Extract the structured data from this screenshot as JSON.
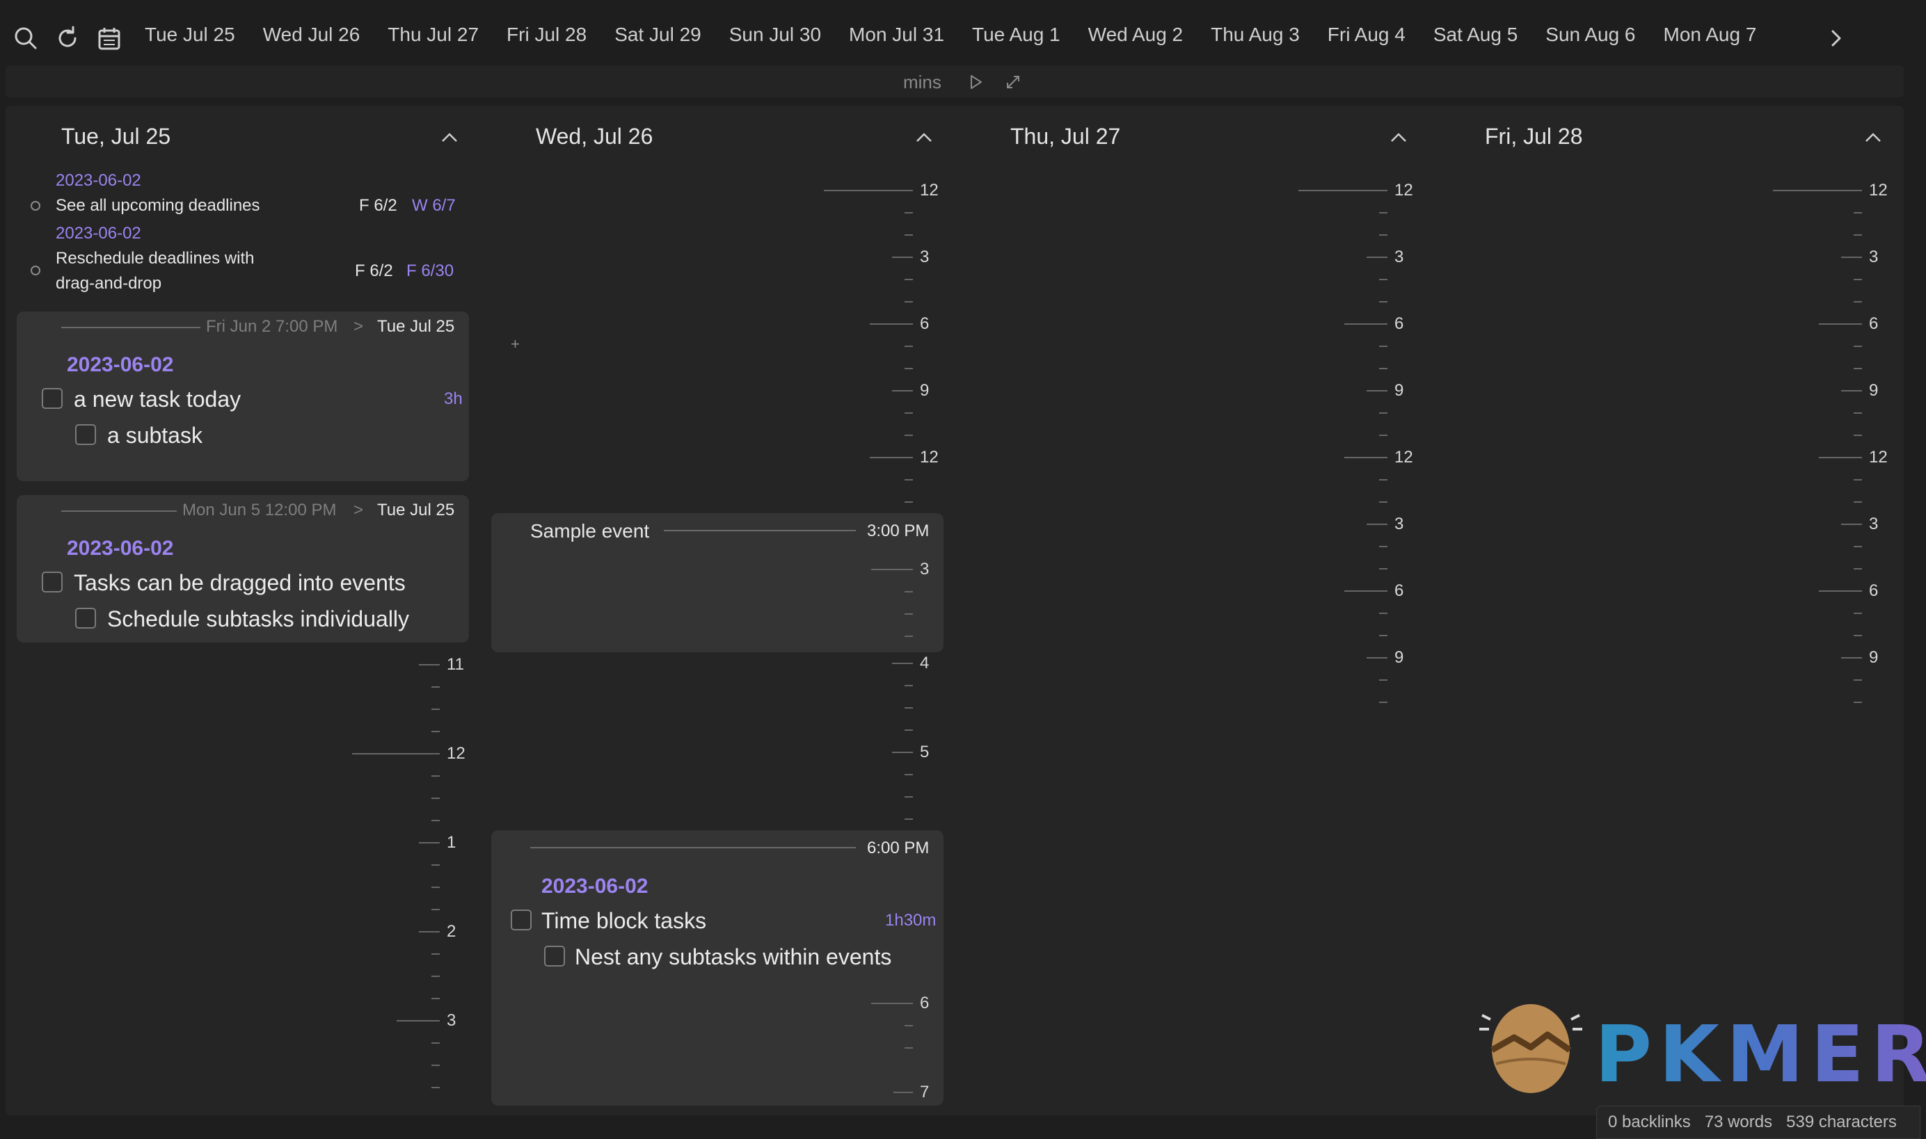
{
  "nav": {
    "dates": [
      "Tue Jul 25",
      "Wed Jul 26",
      "Thu Jul 27",
      "Fri Jul 28",
      "Sat Jul 29",
      "Sun Jul 30",
      "Mon Jul 31",
      "Tue Aug 1",
      "Wed Aug 2",
      "Thu Aug 3",
      "Fri Aug 4",
      "Sat Aug 5",
      "Sun Aug 6",
      "Mon Aug 7"
    ]
  },
  "controls": {
    "unit_label": "mins"
  },
  "columns": [
    {
      "title": "Tue, Jul 25",
      "deadlines": [
        {
          "date": "2023-06-02",
          "text": "See all upcoming deadlines",
          "from": "F 6/2",
          "to": "W 6/7"
        },
        {
          "date": "2023-06-02",
          "text_line1": "Reschedule deadlines with",
          "text_line2": "drag-and-drop",
          "from": "F 6/2",
          "to": "F 6/30"
        }
      ],
      "cards": [
        {
          "from": "Fri Jun 2 7:00 PM",
          "arrow": ">",
          "to": "Tue Jul 25",
          "heading": "2023-06-02",
          "task": "a new task today",
          "duration": "3h",
          "subtask": "a subtask"
        },
        {
          "from": "Mon Jun 5 12:00 PM",
          "arrow": ">",
          "to": "Tue Jul 25",
          "heading": "2023-06-02",
          "task": "Tasks can be dragged into events",
          "subtask": "Schedule subtasks individually"
        }
      ],
      "ticks": [
        "11",
        "12",
        "1",
        "2",
        "3"
      ]
    },
    {
      "title": "Wed, Jul 26",
      "add_symbol": "+",
      "ticks_top": [
        "12",
        "3",
        "6",
        "9",
        "12"
      ],
      "event1": {
        "title": "Sample event",
        "time": "3:00 PM",
        "tick": "3"
      },
      "ticks_mid": [
        "4",
        "5"
      ],
      "event2": {
        "time": "6:00 PM",
        "heading": "2023-06-02",
        "task": "Time block tasks",
        "duration": "1h30m",
        "subtask": "Nest any subtasks within events",
        "ticks": [
          "6",
          "7"
        ]
      }
    },
    {
      "title": "Thu, Jul 27",
      "ticks": [
        "12",
        "3",
        "6",
        "9",
        "12",
        "3",
        "6",
        "9"
      ]
    },
    {
      "title": "Fri, Jul 28",
      "ticks": [
        "12",
        "3",
        "6",
        "9",
        "12",
        "3",
        "6",
        "9"
      ]
    }
  ],
  "watermark": {
    "text": "PKMER"
  },
  "status": {
    "backlinks": "0 backlinks",
    "words": "73 words",
    "characters": "539 characters"
  },
  "colors": {
    "accent": "#9b84f0",
    "background": "#1e1e1e",
    "card": "#343434"
  }
}
